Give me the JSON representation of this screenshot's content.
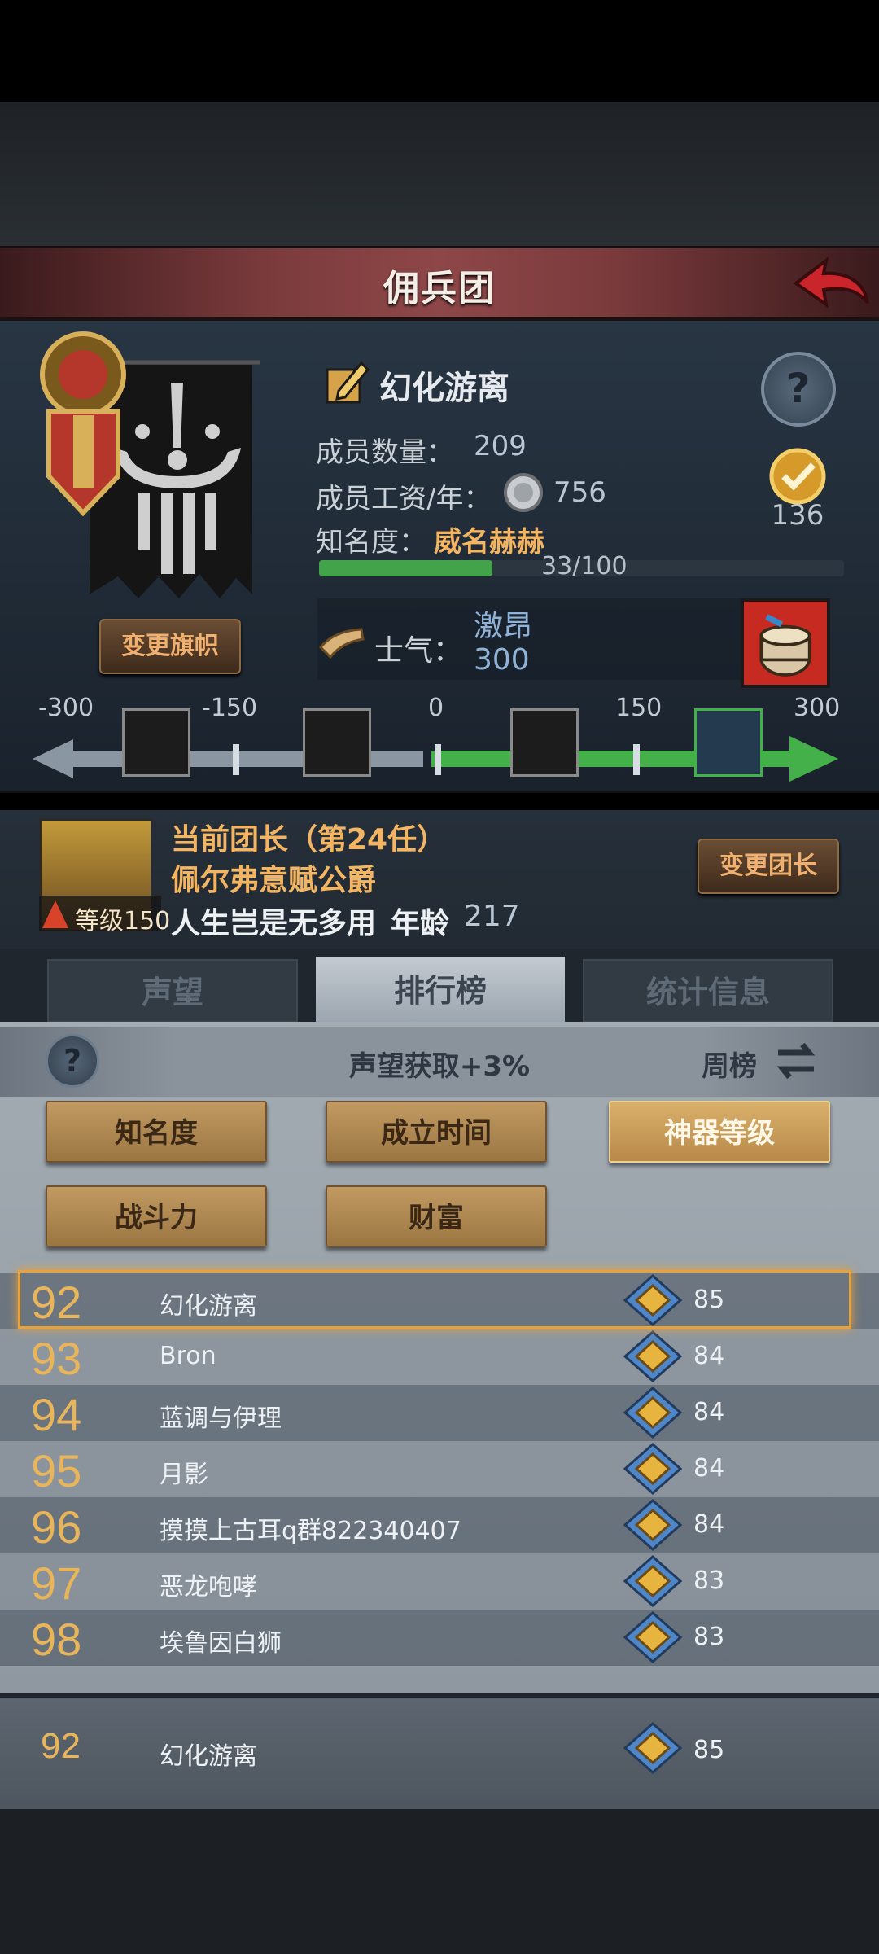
{
  "window": {
    "title": "佣兵团"
  },
  "guild": {
    "name": "幻化游离",
    "change_flag_label": "变更旗帜",
    "members_label": "成员数量：",
    "members_value": "209",
    "salary_label": "成员工资/年：",
    "salary_value": "756",
    "fame_label": "知名度：",
    "fame_value": "威名赫赫",
    "fame_progress_text": "33/100",
    "fame_progress": 0.33,
    "badge_value": "136",
    "morale_label": "士气：",
    "morale_state": "激昂",
    "morale_value": "300"
  },
  "morale_scale": {
    "ticks": [
      "-300",
      "-150",
      "0",
      "150",
      "300"
    ],
    "current": 300
  },
  "leader": {
    "title": "当前团长（第24任）",
    "name": "佩尔弗意赋公爵",
    "level": "等级150",
    "motto": "人生岂是无多用",
    "age_label": "年龄",
    "age_value": "217",
    "change_label": "变更团长"
  },
  "tabs": [
    "声望",
    "排行榜",
    "统计信息"
  ],
  "active_tab": 1,
  "ranking": {
    "reputation_gain": "声望获取+3%",
    "period": "周榜",
    "sort_buttons": [
      "知名度",
      "成立时间",
      "神器等级",
      "战斗力",
      "财富"
    ],
    "active_sort": 2,
    "rows": [
      {
        "rank": "92",
        "name": "幻化游离",
        "value": "85"
      },
      {
        "rank": "93",
        "name": "Bron",
        "value": "84"
      },
      {
        "rank": "94",
        "name": "蓝调与伊理",
        "value": "84"
      },
      {
        "rank": "95",
        "name": "月影",
        "value": "84"
      },
      {
        "rank": "96",
        "name": "摸摸上古耳q群822340407",
        "value": "84"
      },
      {
        "rank": "97",
        "name": "恶龙咆哮",
        "value": "83"
      },
      {
        "rank": "98",
        "name": "埃鲁因白狮",
        "value": "83"
      }
    ],
    "my_row": {
      "rank": "92",
      "name": "幻化游离",
      "value": "85"
    }
  },
  "colors": {
    "accent_gold": "#e9b55b",
    "leader_gold": "#f3b561",
    "morale_green": "#43b04a",
    "selected_border": "#e8a23b"
  }
}
